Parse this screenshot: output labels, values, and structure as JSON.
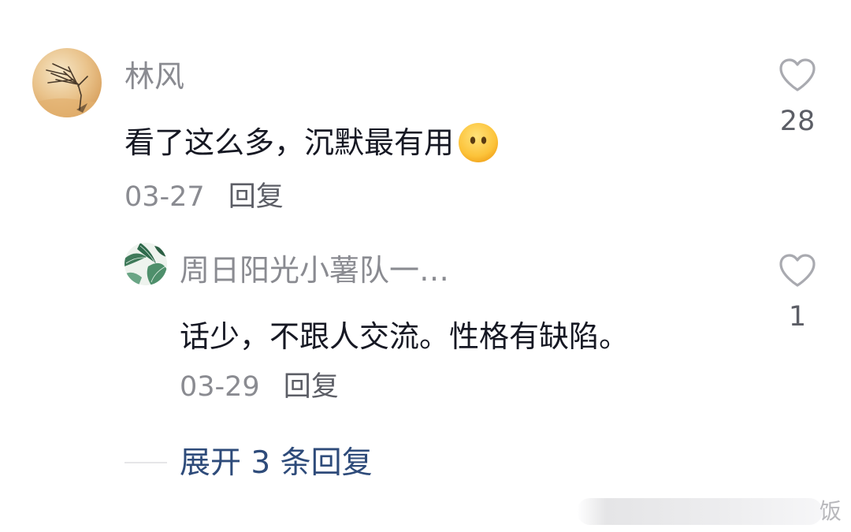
{
  "main_comment": {
    "username": "林风",
    "text": "看了这么多，沉默最有用",
    "emoji": "speechless-face-emoji",
    "date": "03-27",
    "reply_label": "回复",
    "likes": "28"
  },
  "reply_comment": {
    "username": "周日阳光小薯队一…",
    "text": "话少，不跟人交流。性格有缺陷。",
    "date": "03-29",
    "reply_label": "回复",
    "likes": "1"
  },
  "expand": {
    "label": "展开 3 条回复"
  },
  "watermark": {
    "char": "饭"
  },
  "colors": {
    "username": "#8a8b91",
    "text": "#161823",
    "meta": "#8a8b91",
    "link": "#2e4b7a",
    "heart": "#a9aab0"
  }
}
